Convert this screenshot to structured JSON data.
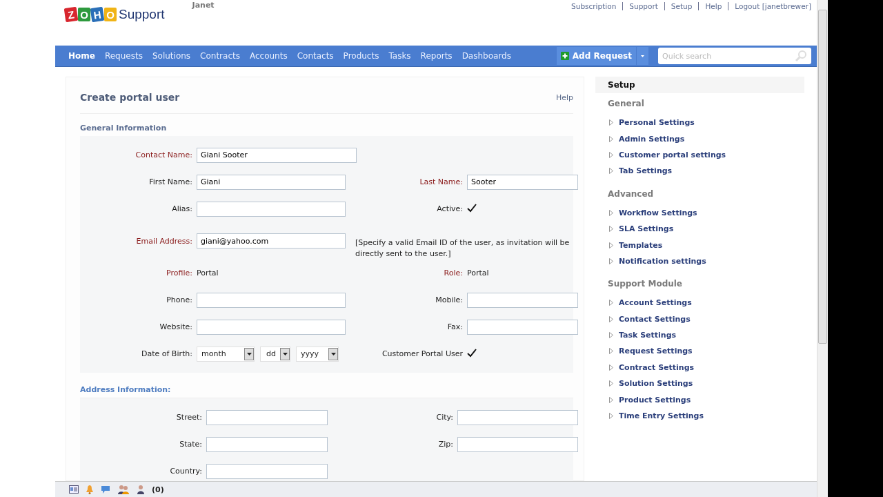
{
  "header": {
    "logo_letters": [
      "Z",
      "O",
      "H",
      "O"
    ],
    "logo_text": "Support",
    "user": "Janet",
    "top_links": [
      "Subscription",
      "Support",
      "Setup",
      "Help",
      "Logout [janetbrewer]"
    ]
  },
  "nav": {
    "items": [
      {
        "label": "Home",
        "selected": true
      },
      {
        "label": "Requests",
        "selected": false
      },
      {
        "label": "Solutions",
        "selected": false
      },
      {
        "label": "Contracts",
        "selected": false
      },
      {
        "label": "Accounts",
        "selected": false
      },
      {
        "label": "Contacts",
        "selected": false
      },
      {
        "label": "Products",
        "selected": false
      },
      {
        "label": "Tasks",
        "selected": false
      },
      {
        "label": "Reports",
        "selected": false
      },
      {
        "label": "Dashboards",
        "selected": false
      }
    ],
    "add_button": "Add Request",
    "search": {
      "placeholder": "Quick search"
    }
  },
  "form": {
    "title": "Create portal user",
    "help": "Help",
    "sections": [
      {
        "title": "General Information",
        "rows": [
          {
            "left": {
              "label": "Contact Name:",
              "required": true,
              "kind": "lookup",
              "value": "Giani Sooter"
            }
          },
          {
            "left": {
              "label": "First Name:",
              "required": false,
              "kind": "input",
              "value": "Giani"
            },
            "right": {
              "label": "Last Name:",
              "required": true,
              "kind": "input",
              "value": "Sooter"
            }
          },
          {
            "left": {
              "label": "Alias:",
              "required": false,
              "kind": "input"
            },
            "right": {
              "label": "Active:",
              "required": false,
              "kind": "check",
              "checked": true
            }
          },
          {
            "left": {
              "label": "Email Address:",
              "required": true,
              "kind": "input",
              "value": "giani@yahoo.com"
            },
            "right": {
              "kind": "note",
              "value": "[Specify a valid Email ID of the user, as invitation will be directly sent to the user.]"
            }
          },
          {
            "left": {
              "label": "Profile:",
              "required": true,
              "kind": "text",
              "value": "Portal"
            },
            "right": {
              "label": "Role:",
              "required": true,
              "kind": "text",
              "value": "Portal"
            }
          },
          {
            "left": {
              "label": "Phone:",
              "required": false,
              "kind": "input"
            },
            "right": {
              "label": "Mobile:",
              "required": false,
              "kind": "input"
            }
          },
          {
            "left": {
              "label": "Website:",
              "required": false,
              "kind": "input"
            },
            "right": {
              "label": "Fax:",
              "required": false,
              "kind": "input"
            }
          },
          {
            "left": {
              "label": "Date of Birth:",
              "required": false,
              "kind": "date",
              "selects": [
                "month",
                "dd",
                "yyyy"
              ]
            },
            "right": {
              "label": "Customer Portal User",
              "required": false,
              "kind": "check",
              "checked": true
            }
          }
        ]
      },
      {
        "title": "Address Information:",
        "rows": [
          {
            "left": {
              "label": "Street:",
              "required": false,
              "kind": "input"
            },
            "right": {
              "label": "City:",
              "required": false,
              "kind": "input"
            }
          },
          {
            "left": {
              "label": "State:",
              "required": false,
              "kind": "input"
            },
            "right": {
              "label": "Zip:",
              "required": false,
              "kind": "input"
            }
          },
          {
            "left": {
              "label": "Country:",
              "required": false,
              "kind": "input"
            }
          }
        ]
      }
    ]
  },
  "sidebar": {
    "title": "Setup",
    "groups": [
      {
        "title": "General",
        "items": [
          "Personal Settings",
          "Admin Settings",
          "Customer portal settings",
          "Tab Settings"
        ]
      },
      {
        "title": "Advanced",
        "items": [
          "Workflow Settings",
          "SLA Settings",
          "Templates",
          "Notification settings"
        ]
      },
      {
        "title": "Support Module",
        "items": [
          "Account Settings",
          "Contact Settings",
          "Task Settings",
          "Request Settings",
          "Contract Settings",
          "Solution Settings",
          "Product Settings",
          "Time Entry Settings"
        ]
      }
    ]
  },
  "status_bar": {
    "count": "(0)"
  }
}
